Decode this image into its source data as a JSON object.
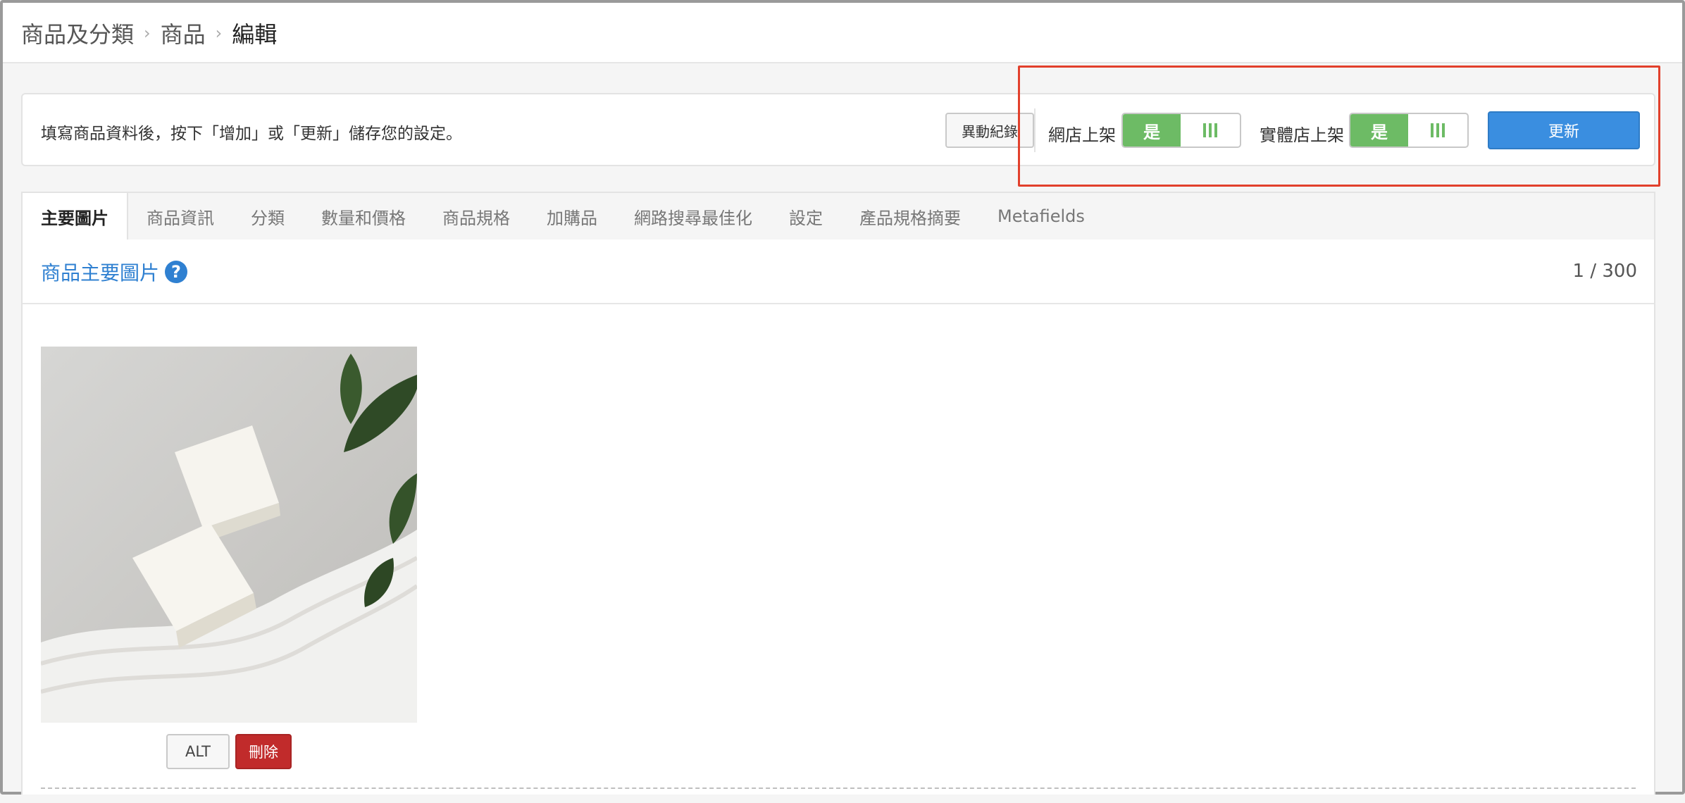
{
  "breadcrumb": {
    "items": [
      "商品及分類",
      "商品"
    ],
    "current": "編輯",
    "separator": "›"
  },
  "actionbar": {
    "hint": "填寫商品資料後，按下「增加」或「更新」儲存您的設定。",
    "log_button": "異動紀錄",
    "online_label": "網店上架",
    "online_value": "是",
    "retail_label": "實體店上架",
    "retail_value": "是",
    "update_button": "更新"
  },
  "tabs": [
    {
      "label": "主要圖片",
      "active": true
    },
    {
      "label": "商品資訊",
      "active": false
    },
    {
      "label": "分類",
      "active": false
    },
    {
      "label": "數量和價格",
      "active": false
    },
    {
      "label": "商品規格",
      "active": false
    },
    {
      "label": "加購品",
      "active": false
    },
    {
      "label": "網路搜尋最佳化",
      "active": false
    },
    {
      "label": "設定",
      "active": false
    },
    {
      "label": "產品規格摘要",
      "active": false
    },
    {
      "label": "Metafields",
      "active": false
    }
  ],
  "section": {
    "title": "商品主要圖片",
    "help_icon": "question-circle-icon",
    "count": "1 / 300"
  },
  "image": {
    "alt_button": "ALT",
    "delete_button": "刪除"
  },
  "colors": {
    "accent": "#3a8ee0",
    "toggle_on": "#6dbb65",
    "danger": "#c12b2b",
    "highlight": "#e2402c",
    "link": "#2f80d1"
  }
}
